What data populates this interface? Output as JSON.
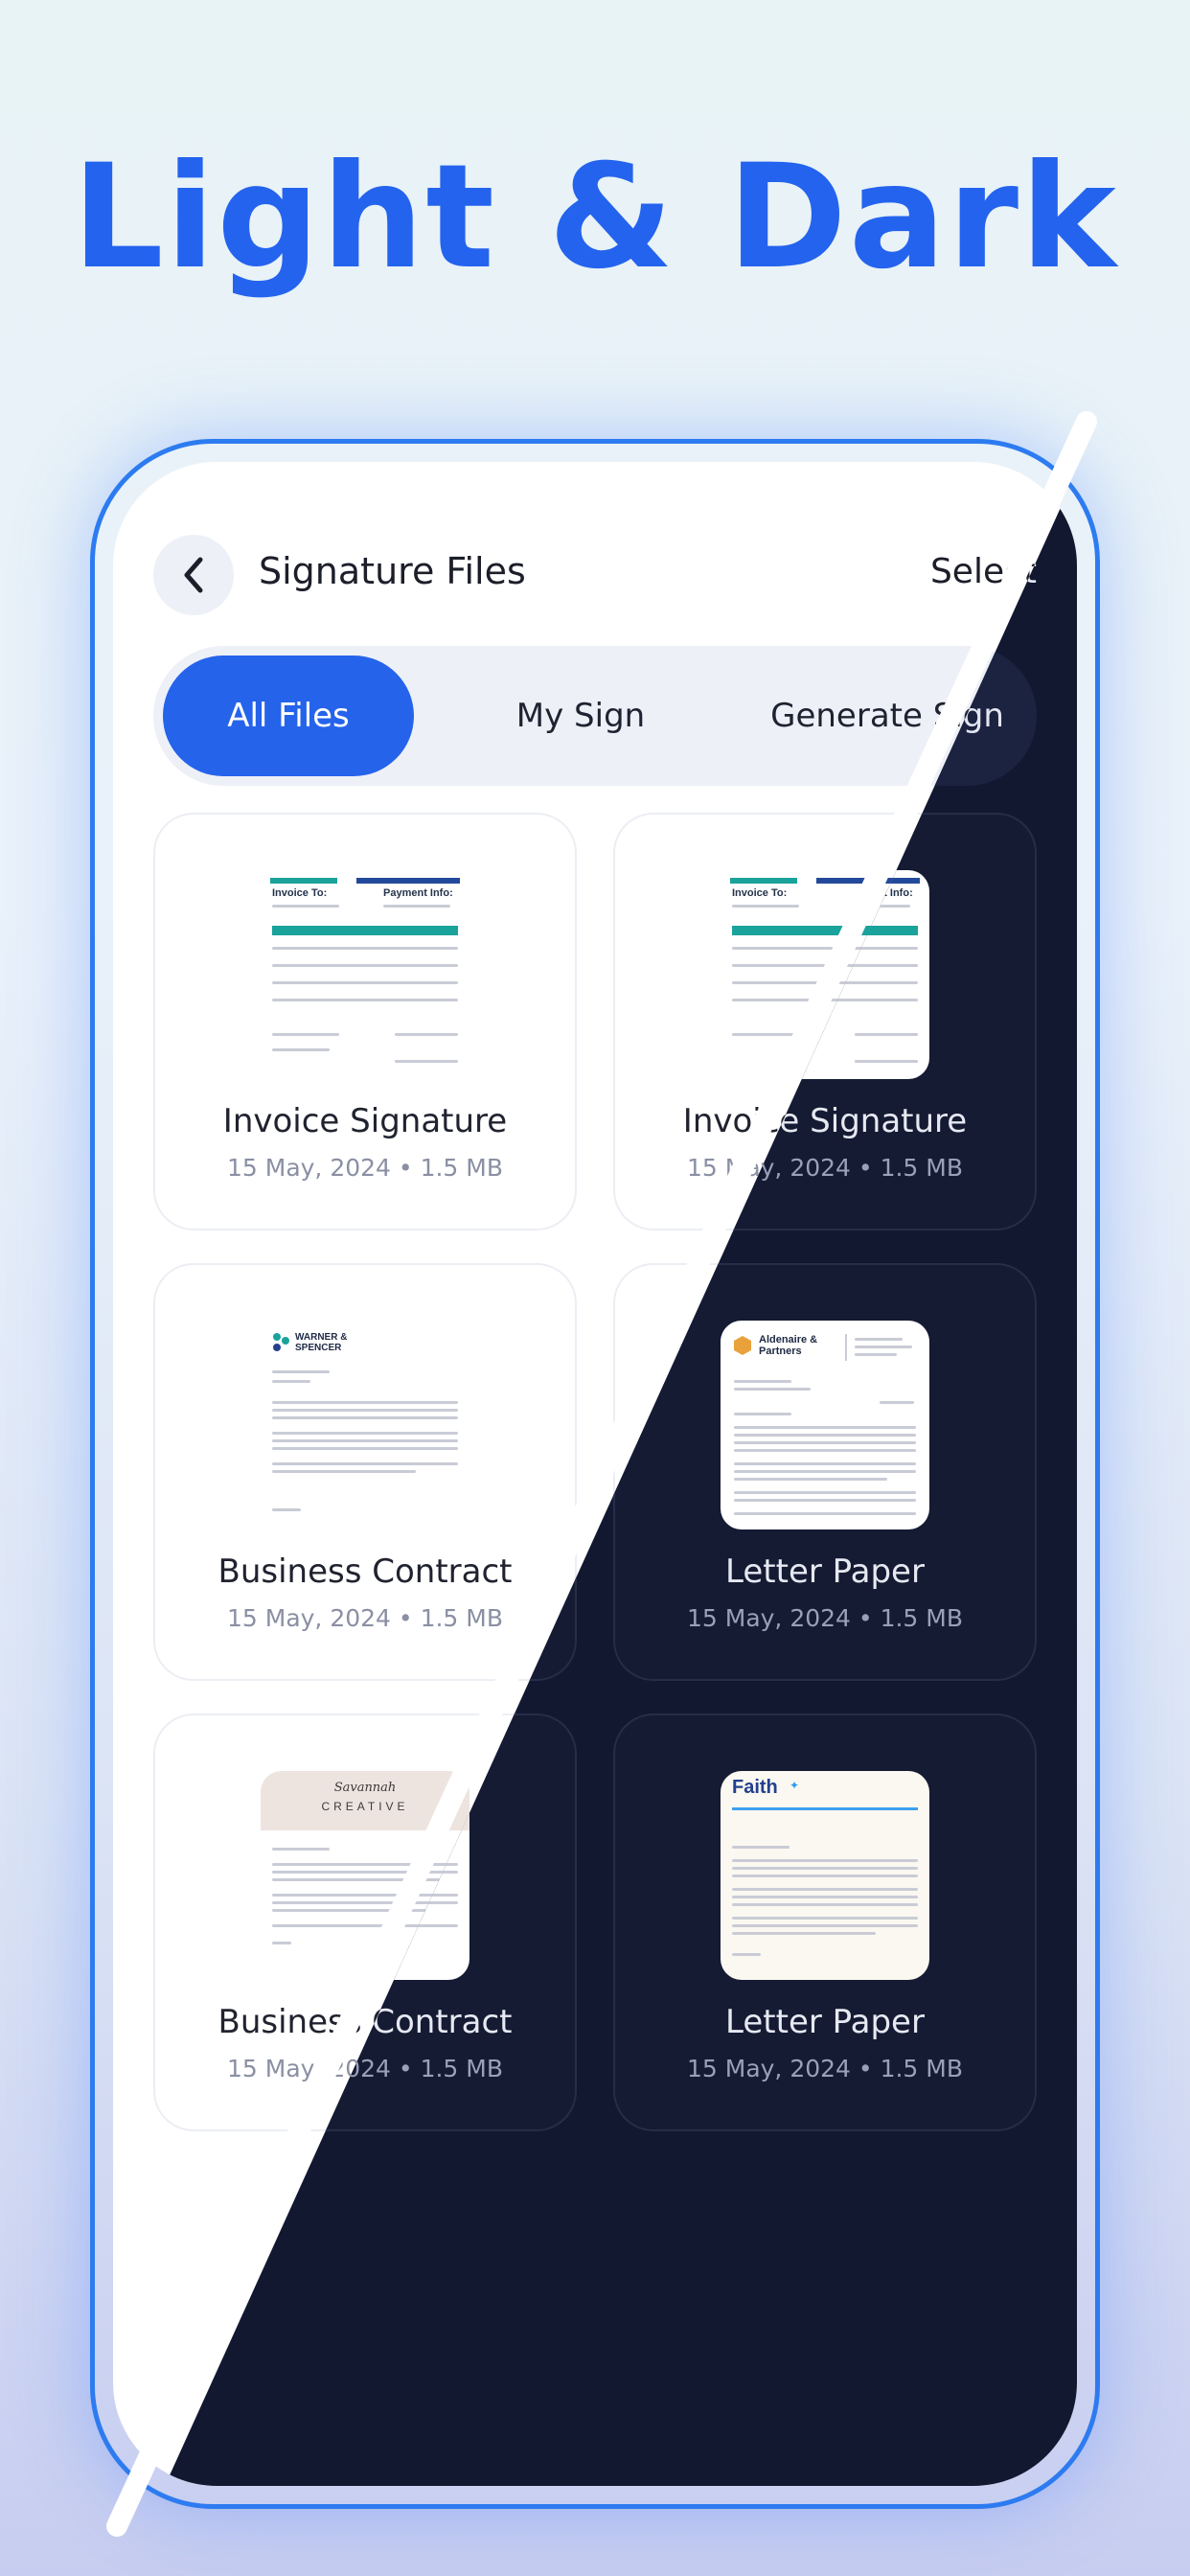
{
  "headline": "Light & Dark",
  "header": {
    "title": "Signature Files",
    "select_label": "Select"
  },
  "tabs": [
    {
      "label": "All Files",
      "active": true
    },
    {
      "label": "My Sign",
      "active": false
    },
    {
      "label": "Generate Sign",
      "active": false
    }
  ],
  "files": [
    {
      "title": "Invoice Signature",
      "meta": "15 May, 2024 • 1.5 MB",
      "thumb": "invoice"
    },
    {
      "title": "Invoice Signature",
      "meta": "15 May, 2024 • 1.5 MB",
      "thumb": "invoice"
    },
    {
      "title": "Business Contract",
      "meta": "15 May, 2024 • 1.5 MB",
      "thumb": "contract"
    },
    {
      "title": "Letter Paper",
      "meta": "15 May, 2024 • 1.5 MB",
      "thumb": "letter"
    },
    {
      "title": "Business Contract",
      "meta": "15 May, 2024 • 1.5 MB",
      "thumb": "creative"
    },
    {
      "title": "Letter Paper",
      "meta": "15 May, 2024 • 1.5 MB",
      "thumb": "faith"
    }
  ],
  "thumb_text": {
    "invoice_title": "Invoice To:",
    "invoice_payment": "Payment Info:",
    "contract_logo": "WARNER & SPENCER",
    "letter_logo": "Aldenaire & Partners",
    "creative_script": "Savannah",
    "creative_word": "CREATIVE",
    "faith_logo": "Faith"
  },
  "colors": {
    "accent": "#2563eb",
    "headline": "#2463ee",
    "dark_bg": "#121830",
    "light_bg": "#ffffff"
  },
  "icons": {
    "back": "chevron-left-icon"
  }
}
